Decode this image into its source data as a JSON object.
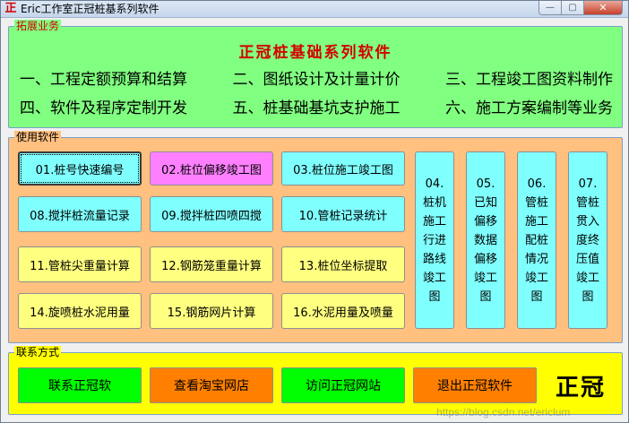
{
  "window": {
    "icon_glyph": "正",
    "title": "Eric工作室正冠桩基系列软件",
    "controls": {
      "minimize": "—",
      "maximize": "▢",
      "close": "✕"
    }
  },
  "business": {
    "legend": "拓展业务",
    "heading": "正冠桩基础系列软件",
    "items": [
      "一、工程定额预算和结算",
      "二、图纸设计及计量计价",
      "三、工程竣工图资料制作",
      "四、软件及程序定制开发",
      "五、桩基础基坑支护施工",
      "六、施工方案编制等业务"
    ]
  },
  "software": {
    "legend": "使用软件",
    "buttons": {
      "b01": "01.桩号快速编号",
      "b02": "02.桩位偏移竣工图",
      "b03": "03.桩位施工竣工图",
      "b04": "04.桩机施工行进路线竣工图",
      "b05": "05.已知偏移数据偏移竣工图",
      "b06": "06.管桩施工配桩情况竣工图",
      "b07": "07.管桩贯入度终压值竣工图",
      "b08": "08.搅拌桩流量记录",
      "b09": "09.搅拌桩四喷四搅",
      "b10": "10.管桩记录统计",
      "b11": "11.管桩尖重量计算",
      "b12": "12.钢筋笼重量计算",
      "b13": "13.桩位坐标提取",
      "b14": "14.旋喷桩水泥用量",
      "b15": "15.钢筋网片计算",
      "b16": "16.水泥用量及喷量"
    }
  },
  "contact": {
    "legend": "联系方式",
    "buttons": {
      "contact": "联系正冠软",
      "taobao": "查看淘宝网店",
      "website": "访问正冠网站",
      "exit": "退出正冠软件"
    },
    "brand": "正冠"
  },
  "watermark": "https://blog.csdn.net/ericlum"
}
